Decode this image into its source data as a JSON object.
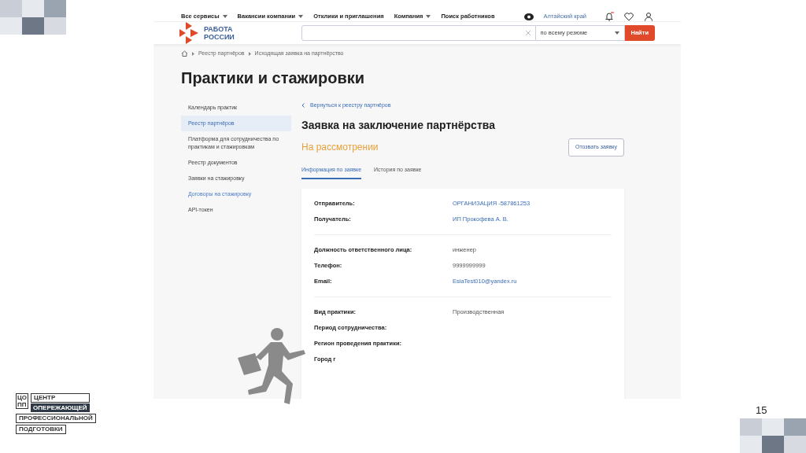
{
  "top_nav": {
    "items": [
      {
        "label": "Все сервисы",
        "dropdown": true
      },
      {
        "label": "Вакансии компании",
        "dropdown": true
      },
      {
        "label": "Отклики и приглашения",
        "dropdown": false
      },
      {
        "label": "Компания",
        "dropdown": true
      },
      {
        "label": "Поиск работников",
        "dropdown": false
      }
    ],
    "region": "Алтайский край"
  },
  "header": {
    "logo": [
      "РАБОТА",
      "РОССИИ"
    ],
    "search": {
      "scope": "по всему резюме",
      "button": "Найти"
    }
  },
  "breadcrumbs": [
    "Реестр партнёров",
    "Исходящая заявка на партнёрство"
  ],
  "page_title": "Практики и стажировки",
  "sidebar": {
    "items": [
      {
        "label": "Календарь практик",
        "selected": false,
        "hovered": false
      },
      {
        "label": "Реестр партнёров",
        "selected": true,
        "hovered": false
      },
      {
        "label": "Платформа для сотрудничества по практикам и стажировкам",
        "selected": false,
        "hovered": false
      },
      {
        "label": "Реестр документов",
        "selected": false,
        "hovered": false
      },
      {
        "label": "Заявки на стажировку",
        "selected": false,
        "hovered": false
      },
      {
        "label": "Договоры на стажировку",
        "selected": false,
        "hovered": true
      },
      {
        "label": "API-токен",
        "selected": false,
        "hovered": false
      }
    ]
  },
  "main": {
    "back_link": "Вернуться к реестру партнёров",
    "title": "Заявка на заключение партнёрства",
    "status": "На рассмотрении",
    "action_button": "Отозвать заявку",
    "tabs": [
      {
        "label": "Информация по заявке",
        "selected": true
      },
      {
        "label": "История по заявке",
        "selected": false
      }
    ],
    "groups": [
      [
        {
          "label": "Отправитель:",
          "value": "ОРГАНИЗАЦИЯ -587861253",
          "kind": "link"
        },
        {
          "label": "Получатель:",
          "value": "ИП Прокофева А. В.",
          "kind": "link"
        }
      ],
      [
        {
          "label": "Должность ответственного лица:",
          "value": "инженер",
          "kind": "plain"
        },
        {
          "label": "Телефон:",
          "value": "9999999999",
          "kind": "plain"
        },
        {
          "label": "Email:",
          "value": "EsiaTest010@yandex.ru",
          "kind": "link"
        }
      ],
      [
        {
          "label": "Вид практики:",
          "value": "Производственная",
          "kind": "plain"
        },
        {
          "label": "Период сотрудничества:"
        },
        {
          "label": "Регион проведения практики:"
        },
        {
          "label": "Город г"
        }
      ]
    ]
  },
  "slide": {
    "logo_mark": [
      "ЦО",
      "ПП"
    ],
    "logo_lines": [
      "ЦЕНТР",
      "ОПЕРЕЖАЮЩЕЙ",
      "ПРОФЕССИОНАЛЬНОЙ",
      "ПОДГОТОВКИ"
    ],
    "page_number": "15"
  }
}
